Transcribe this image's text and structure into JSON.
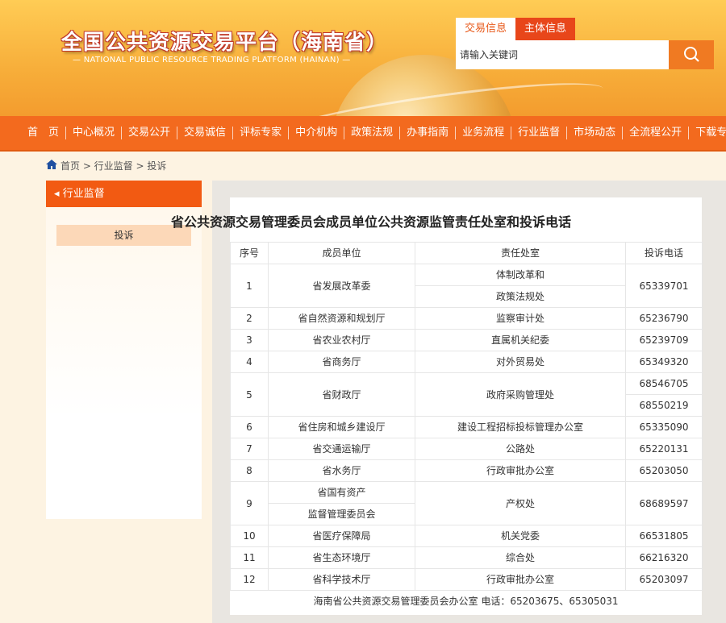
{
  "header": {
    "title": "全国公共资源交易平台（海南省）",
    "subtitle": "— NATIONAL PUBLIC RESOURCE TRADING PLATFORM (HAINAN) —",
    "search_tabs": [
      "交易信息",
      "主体信息"
    ],
    "search_placeholder": "请输入关键词",
    "search_icon": "search-icon"
  },
  "nav": [
    "首　页",
    "中心概况",
    "交易公开",
    "交易诚信",
    "评标专家",
    "中介机构",
    "政策法规",
    "办事指南",
    "业务流程",
    "行业监督",
    "市场动态",
    "全流程公开",
    "下载专区"
  ],
  "breadcrumb": {
    "icon": "home-icon",
    "text": "首页 > 行业监督 > 投诉"
  },
  "sidebar": {
    "header": "◂ 行业监督",
    "items": [
      "投诉"
    ]
  },
  "main": {
    "title": "省公共资源交易管理委员会成员单位公共资源监管责任处室和投诉电话",
    "columns": [
      "序号",
      "成员单位",
      "责任处室",
      "投诉电话"
    ],
    "rows": [
      {
        "no": "1",
        "unit": "省发展改革委",
        "office": [
          "体制改革和",
          "政策法规处"
        ],
        "phone": [
          "65339701"
        ]
      },
      {
        "no": "2",
        "unit": "省自然资源和规划厅",
        "office": [
          "监察审计处"
        ],
        "phone": [
          "65236790"
        ]
      },
      {
        "no": "3",
        "unit": "省农业农村厅",
        "office": [
          "直属机关纪委"
        ],
        "phone": [
          "65239709"
        ]
      },
      {
        "no": "4",
        "unit": "省商务厅",
        "office": [
          "对外贸易处"
        ],
        "phone": [
          "65349320"
        ]
      },
      {
        "no": "5",
        "unit": "省财政厅",
        "office": [
          "政府采购管理处"
        ],
        "phone": [
          "68546705",
          "68550219"
        ]
      },
      {
        "no": "6",
        "unit": "省住房和城乡建设厅",
        "office": [
          "建设工程招标投标管理办公室"
        ],
        "phone": [
          "65335090"
        ]
      },
      {
        "no": "7",
        "unit": "省交通运输厅",
        "office": [
          "公路处"
        ],
        "phone": [
          "65220131"
        ]
      },
      {
        "no": "8",
        "unit": "省水务厅",
        "office": [
          "行政审批办公室"
        ],
        "phone": [
          "65203050"
        ]
      },
      {
        "no": "9",
        "unit": [
          "省国有资产",
          "监督管理委员会"
        ],
        "office": [
          "产权处"
        ],
        "phone": [
          "68689597"
        ]
      },
      {
        "no": "10",
        "unit": "省医疗保障局",
        "office": [
          "机关党委"
        ],
        "phone": [
          "66531805"
        ]
      },
      {
        "no": "11",
        "unit": "省生态环境厅",
        "office": [
          "综合处"
        ],
        "phone": [
          "66216320"
        ]
      },
      {
        "no": "12",
        "unit": "省科学技术厅",
        "office": [
          "行政审批办公室"
        ],
        "phone": [
          "65203097"
        ]
      }
    ],
    "footer": "海南省公共资源交易管理委员会办公室  电话：65203675、65305031"
  }
}
